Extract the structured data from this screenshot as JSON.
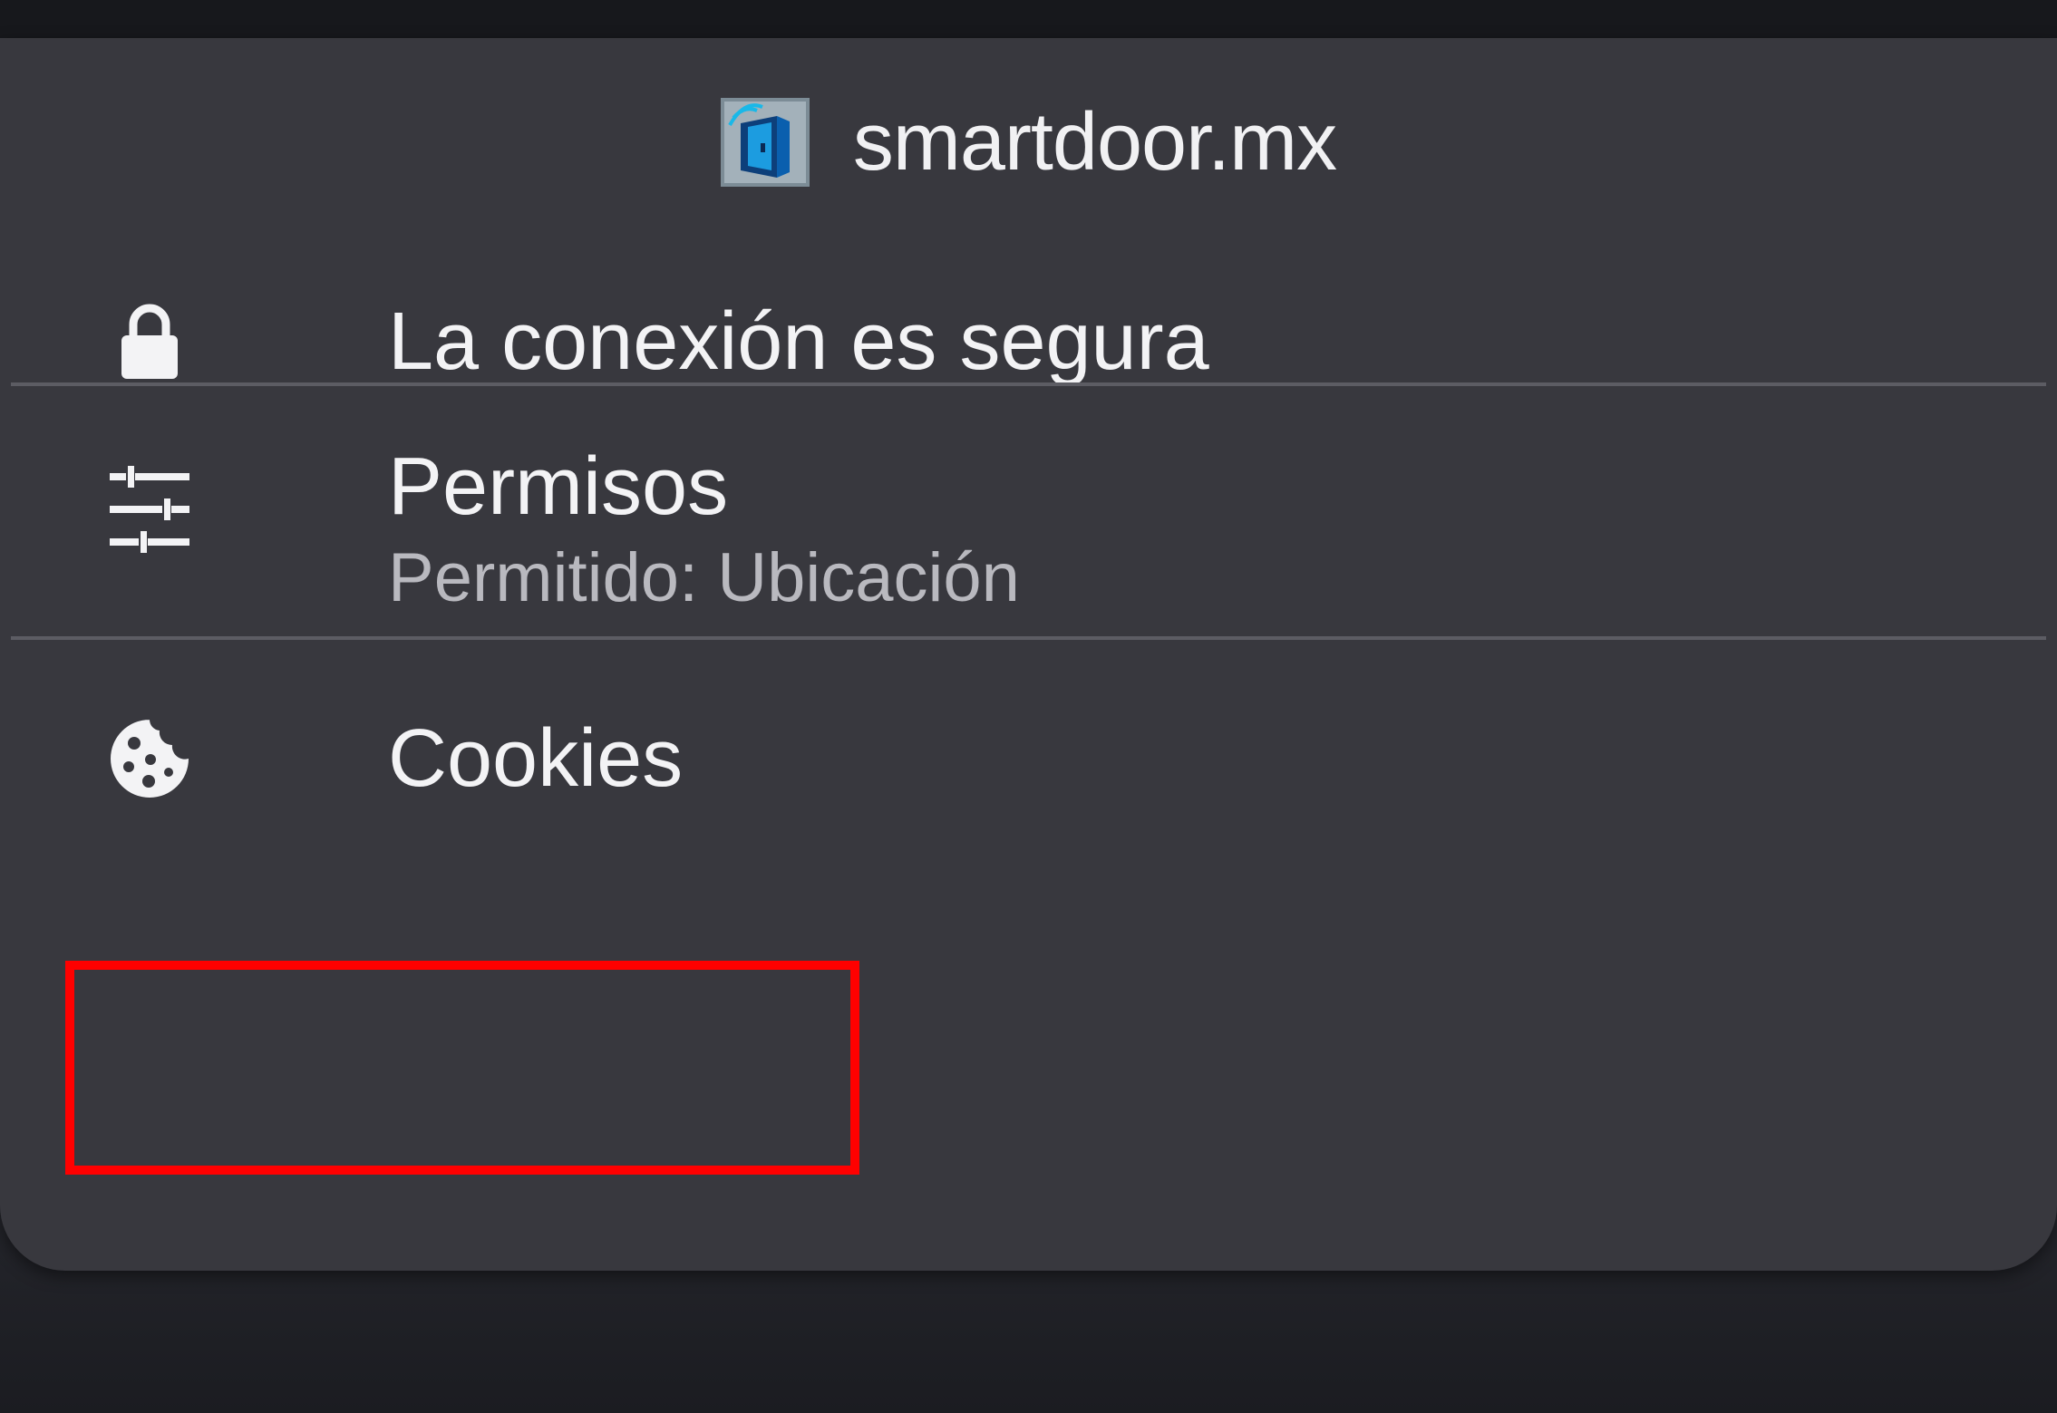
{
  "site": {
    "domain": "smartdoor.mx",
    "favicon_icon": "smartdoor-door-logo-icon"
  },
  "rows": {
    "connection": {
      "icon": "lock-icon",
      "title": "La conexión es segura"
    },
    "permissions": {
      "icon": "sliders-icon",
      "title": "Permisos",
      "subtitle": "Permitido: Ubicación"
    },
    "cookies": {
      "icon": "cookie-icon",
      "title": "Cookies",
      "highlighted": true
    }
  },
  "colors": {
    "sheet_background": "#38383e",
    "text_primary": "#f3f3f5",
    "text_secondary": "#b9b9bf",
    "divider": "#5c5c63",
    "highlight": "#ff0000"
  }
}
